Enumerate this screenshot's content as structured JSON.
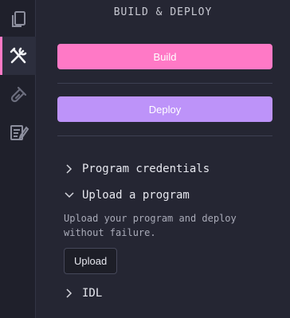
{
  "sidebar": {
    "title": "BUILD & DEPLOY",
    "build_label": "Build",
    "deploy_label": "Deploy",
    "sections": [
      {
        "label": "Program credentials",
        "expanded": false
      },
      {
        "label": "Upload a program",
        "expanded": true,
        "description_line1": "Upload your program and deploy",
        "description_line2": "without failure.",
        "upload_label": "Upload"
      },
      {
        "label": "IDL",
        "expanded": false
      }
    ]
  },
  "activity_bar": {
    "items": [
      {
        "icon": "files-icon",
        "active": false
      },
      {
        "icon": "tools-icon",
        "active": true
      },
      {
        "icon": "test-tube-icon",
        "active": false
      },
      {
        "icon": "edit-document-icon",
        "active": false
      }
    ]
  },
  "colors": {
    "build": "#ff79c6",
    "deploy": "#bd93f9",
    "active_indicator": "#ff7ac6"
  }
}
